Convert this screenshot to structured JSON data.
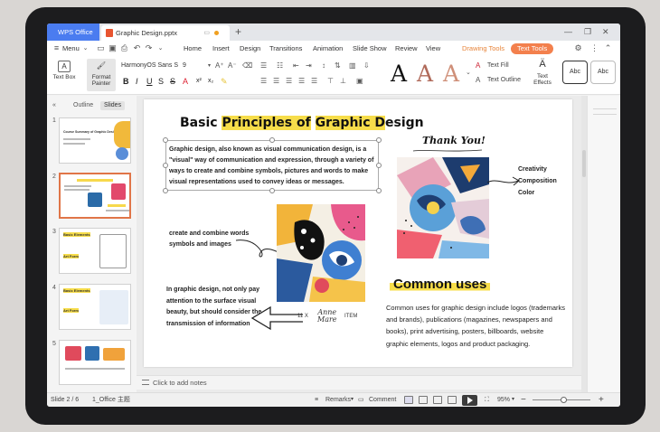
{
  "tabs": {
    "app_tab": "WPS Office",
    "doc_tab": "Graphic Design.pptx"
  },
  "menu": {
    "menu_label": "Menu",
    "items": [
      "Home",
      "Insert",
      "Design",
      "Transitions",
      "Animation",
      "Slide Show",
      "Review",
      "View",
      "Drawing Tools",
      "Text Tools"
    ]
  },
  "ribbon": {
    "text_box": "Text Box",
    "format_painter_1": "Format",
    "format_painter_2": "Painter",
    "font_name": "HarmonyOS Sans S",
    "font_size": "9",
    "text_fill": "Text Fill",
    "text_outline": "Text Outline",
    "text_effects_1": "Text",
    "text_effects_2": "Effects",
    "style1": "Abc",
    "style2": "Abc",
    "big_a": "A"
  },
  "left_panel": {
    "tab_outline": "Outline",
    "tab_slides": "Slides",
    "slide_numbers": [
      "1",
      "2",
      "3",
      "4",
      "5"
    ],
    "thumb1_title": "Course Summary of Graphic Design",
    "thumb3_t1": "Basic Elements",
    "thumb3_t2": "Art Form",
    "thumb4_t1": "Basic Elements",
    "thumb4_t2": "Art Form",
    "selected_slide": 2
  },
  "slide": {
    "title_pre": "Basic ",
    "title_hl1": "Principles of",
    "title_mid": " ",
    "title_hl2": "Graphic D",
    "title_post": "esign",
    "body": "Graphic design, also known as visual communication design, is a \"visual\" way of communication and expression, through a variety of ways to create and combine symbols, pictures and words to make visual representations used to convey ideas or messages.",
    "note1": "create and combine words symbols and images",
    "note2": "In graphic design, not only pay attention to the surface visual beauty, but should consider the transmission of information",
    "thanks": "Thank You!",
    "label_creativity": "Creativity",
    "label_composition": "Composition",
    "label_color": "Color",
    "common_title": "Common uses",
    "common_body": "Common uses for graphic design include logos (trademarks and brands), publications (magazines, newspapers and books), print advertising, posters, billboards, website graphic elements, logos and product packaging.",
    "sig_left": "11 X",
    "sig_mid1": "Anne",
    "sig_mid2": "Mare",
    "sig_right": "ITEM"
  },
  "notes": {
    "placeholder": "Click to add notes"
  },
  "status": {
    "slide_count": "Slide 2 / 6",
    "theme": "1_Office 主题",
    "remarks": "Remarks",
    "comment": "Comment",
    "zoom": "95%"
  },
  "colors": {
    "accent_blue": "#4a7cf0",
    "accent_orange": "#f3804d",
    "highlight_yellow": "#f7dd4a"
  },
  "icons": [
    "menu-icon",
    "open-folder-icon",
    "save-icon",
    "print-icon",
    "undo-icon",
    "redo-icon",
    "settings-gear-icon",
    "collapse-icon",
    "play-icon",
    "zoom-fit-icon"
  ]
}
